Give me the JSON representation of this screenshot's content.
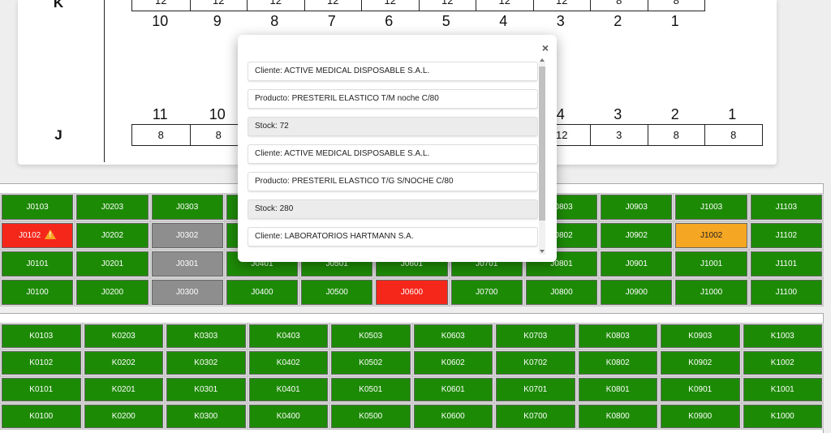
{
  "diagram": {
    "row_k": {
      "letter": "K",
      "capacities": [
        "12",
        "12",
        "12",
        "12",
        "12",
        "12",
        "12",
        "12",
        "8",
        "8"
      ],
      "positions": [
        "10",
        "9",
        "8",
        "7",
        "6",
        "5",
        "4",
        "3",
        "2",
        "1"
      ]
    },
    "row_j": {
      "letter": "J",
      "positions": [
        "11",
        "10",
        "",
        "",
        "",
        "",
        "",
        "4",
        "3",
        "2",
        "1"
      ],
      "capacities": [
        "8",
        "8",
        "",
        "",
        "",
        "",
        "",
        "12",
        "3",
        "8",
        "8"
      ]
    }
  },
  "grid_j": [
    [
      {
        "code": "J0103",
        "status": "green"
      },
      {
        "code": "J0203",
        "status": "green"
      },
      {
        "code": "J0303",
        "status": "green"
      },
      {
        "code": "",
        "status": "green"
      },
      {
        "code": "",
        "status": "green"
      },
      {
        "code": "",
        "status": "green"
      },
      {
        "code": "",
        "status": "green"
      },
      {
        "code": "J0803",
        "status": "green"
      },
      {
        "code": "J0903",
        "status": "green"
      },
      {
        "code": "J1003",
        "status": "green"
      },
      {
        "code": "J1103",
        "status": "green"
      }
    ],
    [
      {
        "code": "J0102",
        "status": "red",
        "warning": true
      },
      {
        "code": "J0202",
        "status": "green"
      },
      {
        "code": "J0302",
        "status": "gray"
      },
      {
        "code": "",
        "status": "green"
      },
      {
        "code": "",
        "status": "green"
      },
      {
        "code": "",
        "status": "green"
      },
      {
        "code": "",
        "status": "green"
      },
      {
        "code": "J0802",
        "status": "green"
      },
      {
        "code": "J0902",
        "status": "green"
      },
      {
        "code": "J1002",
        "status": "orange"
      },
      {
        "code": "J1102",
        "status": "green"
      }
    ],
    [
      {
        "code": "J0101",
        "status": "green"
      },
      {
        "code": "J0201",
        "status": "green"
      },
      {
        "code": "J0301",
        "status": "gray"
      },
      {
        "code": "J0401",
        "status": "green"
      },
      {
        "code": "J0501",
        "status": "green"
      },
      {
        "code": "J0601",
        "status": "green"
      },
      {
        "code": "J0701",
        "status": "green"
      },
      {
        "code": "J0801",
        "status": "green"
      },
      {
        "code": "J0901",
        "status": "green"
      },
      {
        "code": "J1001",
        "status": "green"
      },
      {
        "code": "J1101",
        "status": "green"
      }
    ],
    [
      {
        "code": "J0100",
        "status": "green"
      },
      {
        "code": "J0200",
        "status": "green"
      },
      {
        "code": "J0300",
        "status": "gray"
      },
      {
        "code": "J0400",
        "status": "green"
      },
      {
        "code": "J0500",
        "status": "green"
      },
      {
        "code": "J0600",
        "status": "red"
      },
      {
        "code": "J0700",
        "status": "green"
      },
      {
        "code": "J0800",
        "status": "green"
      },
      {
        "code": "J0900",
        "status": "green"
      },
      {
        "code": "J1000",
        "status": "green"
      },
      {
        "code": "J1100",
        "status": "green"
      }
    ]
  ],
  "grid_k": [
    [
      "K0103",
      "K0203",
      "K0303",
      "K0403",
      "K0503",
      "K0603",
      "K0703",
      "K0803",
      "K0903",
      "K1003"
    ],
    [
      "K0102",
      "K0202",
      "K0302",
      "K0402",
      "K0502",
      "K0602",
      "K0702",
      "K0802",
      "K0902",
      "K1002"
    ],
    [
      "K0101",
      "K0201",
      "K0301",
      "K0401",
      "K0501",
      "K0601",
      "K0701",
      "K0801",
      "K0901",
      "K1001"
    ],
    [
      "K0100",
      "K0200",
      "K0300",
      "K0400",
      "K0500",
      "K0600",
      "K0700",
      "K0800",
      "K0900",
      "K1000"
    ]
  ],
  "colors": {
    "green": "#1d8a06",
    "red": "#f5271b",
    "gray": "#8e8e8e",
    "orange": "#f5a623"
  },
  "modal": {
    "close_label": "×",
    "items": [
      {
        "text": "Cliente: ACTIVE MEDICAL DISPOSABLE S.A.L.",
        "type": "client"
      },
      {
        "text": "Producto: PRESTERIL ELASTICO T/M noche C/80",
        "type": "product"
      },
      {
        "text": "Stock: 72",
        "type": "stock"
      },
      {
        "text": "Cliente: ACTIVE MEDICAL DISPOSABLE S.A.L.",
        "type": "client"
      },
      {
        "text": "Producto: PRESTERIL ELASTICO T/G S/NOCHE C/80",
        "type": "product"
      },
      {
        "text": "Stock: 280",
        "type": "stock"
      },
      {
        "text": "Cliente: LABORATORIOS HARTMANN S.A.",
        "type": "client"
      }
    ]
  }
}
